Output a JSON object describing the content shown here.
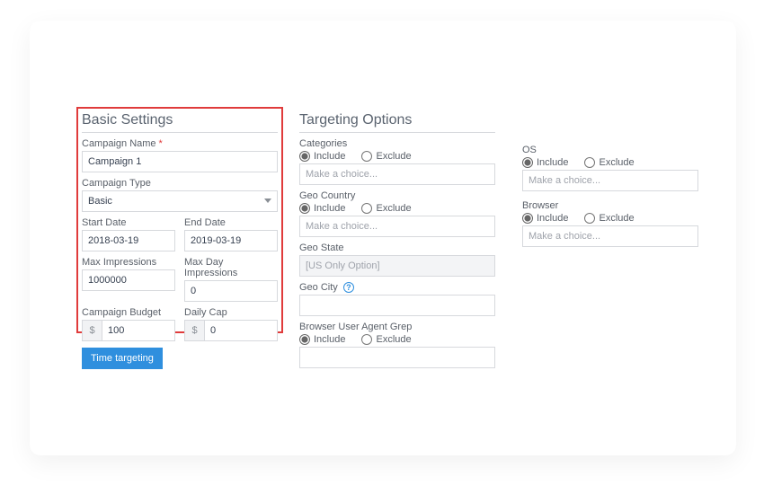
{
  "basic": {
    "title": "Basic Settings",
    "campaign_name_label": "Campaign Name",
    "campaign_name_value": "Campaign 1",
    "campaign_type_label": "Campaign Type",
    "campaign_type_value": "Basic",
    "start_date_label": "Start Date",
    "start_date_value": "2018-03-19",
    "end_date_label": "End Date",
    "end_date_value": "2019-03-19",
    "max_impressions_label": "Max Impressions",
    "max_impressions_value": "1000000",
    "max_day_impressions_label": "Max Day Impressions",
    "max_day_impressions_value": "0",
    "campaign_budget_label": "Campaign Budget",
    "campaign_budget_value": "100",
    "daily_cap_label": "Daily Cap",
    "daily_cap_value": "0",
    "currency_symbol": "$",
    "time_targeting_label": "Time targeting"
  },
  "targeting": {
    "title": "Targeting Options",
    "include_label": "Include",
    "exclude_label": "Exclude",
    "make_choice_placeholder": "Make a choice...",
    "categories_label": "Categories",
    "geo_country_label": "Geo Country",
    "geo_state_label": "Geo State",
    "geo_state_placeholder": "[US Only Option]",
    "geo_city_label": "Geo City",
    "browser_ua_label": "Browser User Agent Grep",
    "help_icon_text": "?"
  },
  "right": {
    "os_label": "OS",
    "browser_label": "Browser"
  }
}
